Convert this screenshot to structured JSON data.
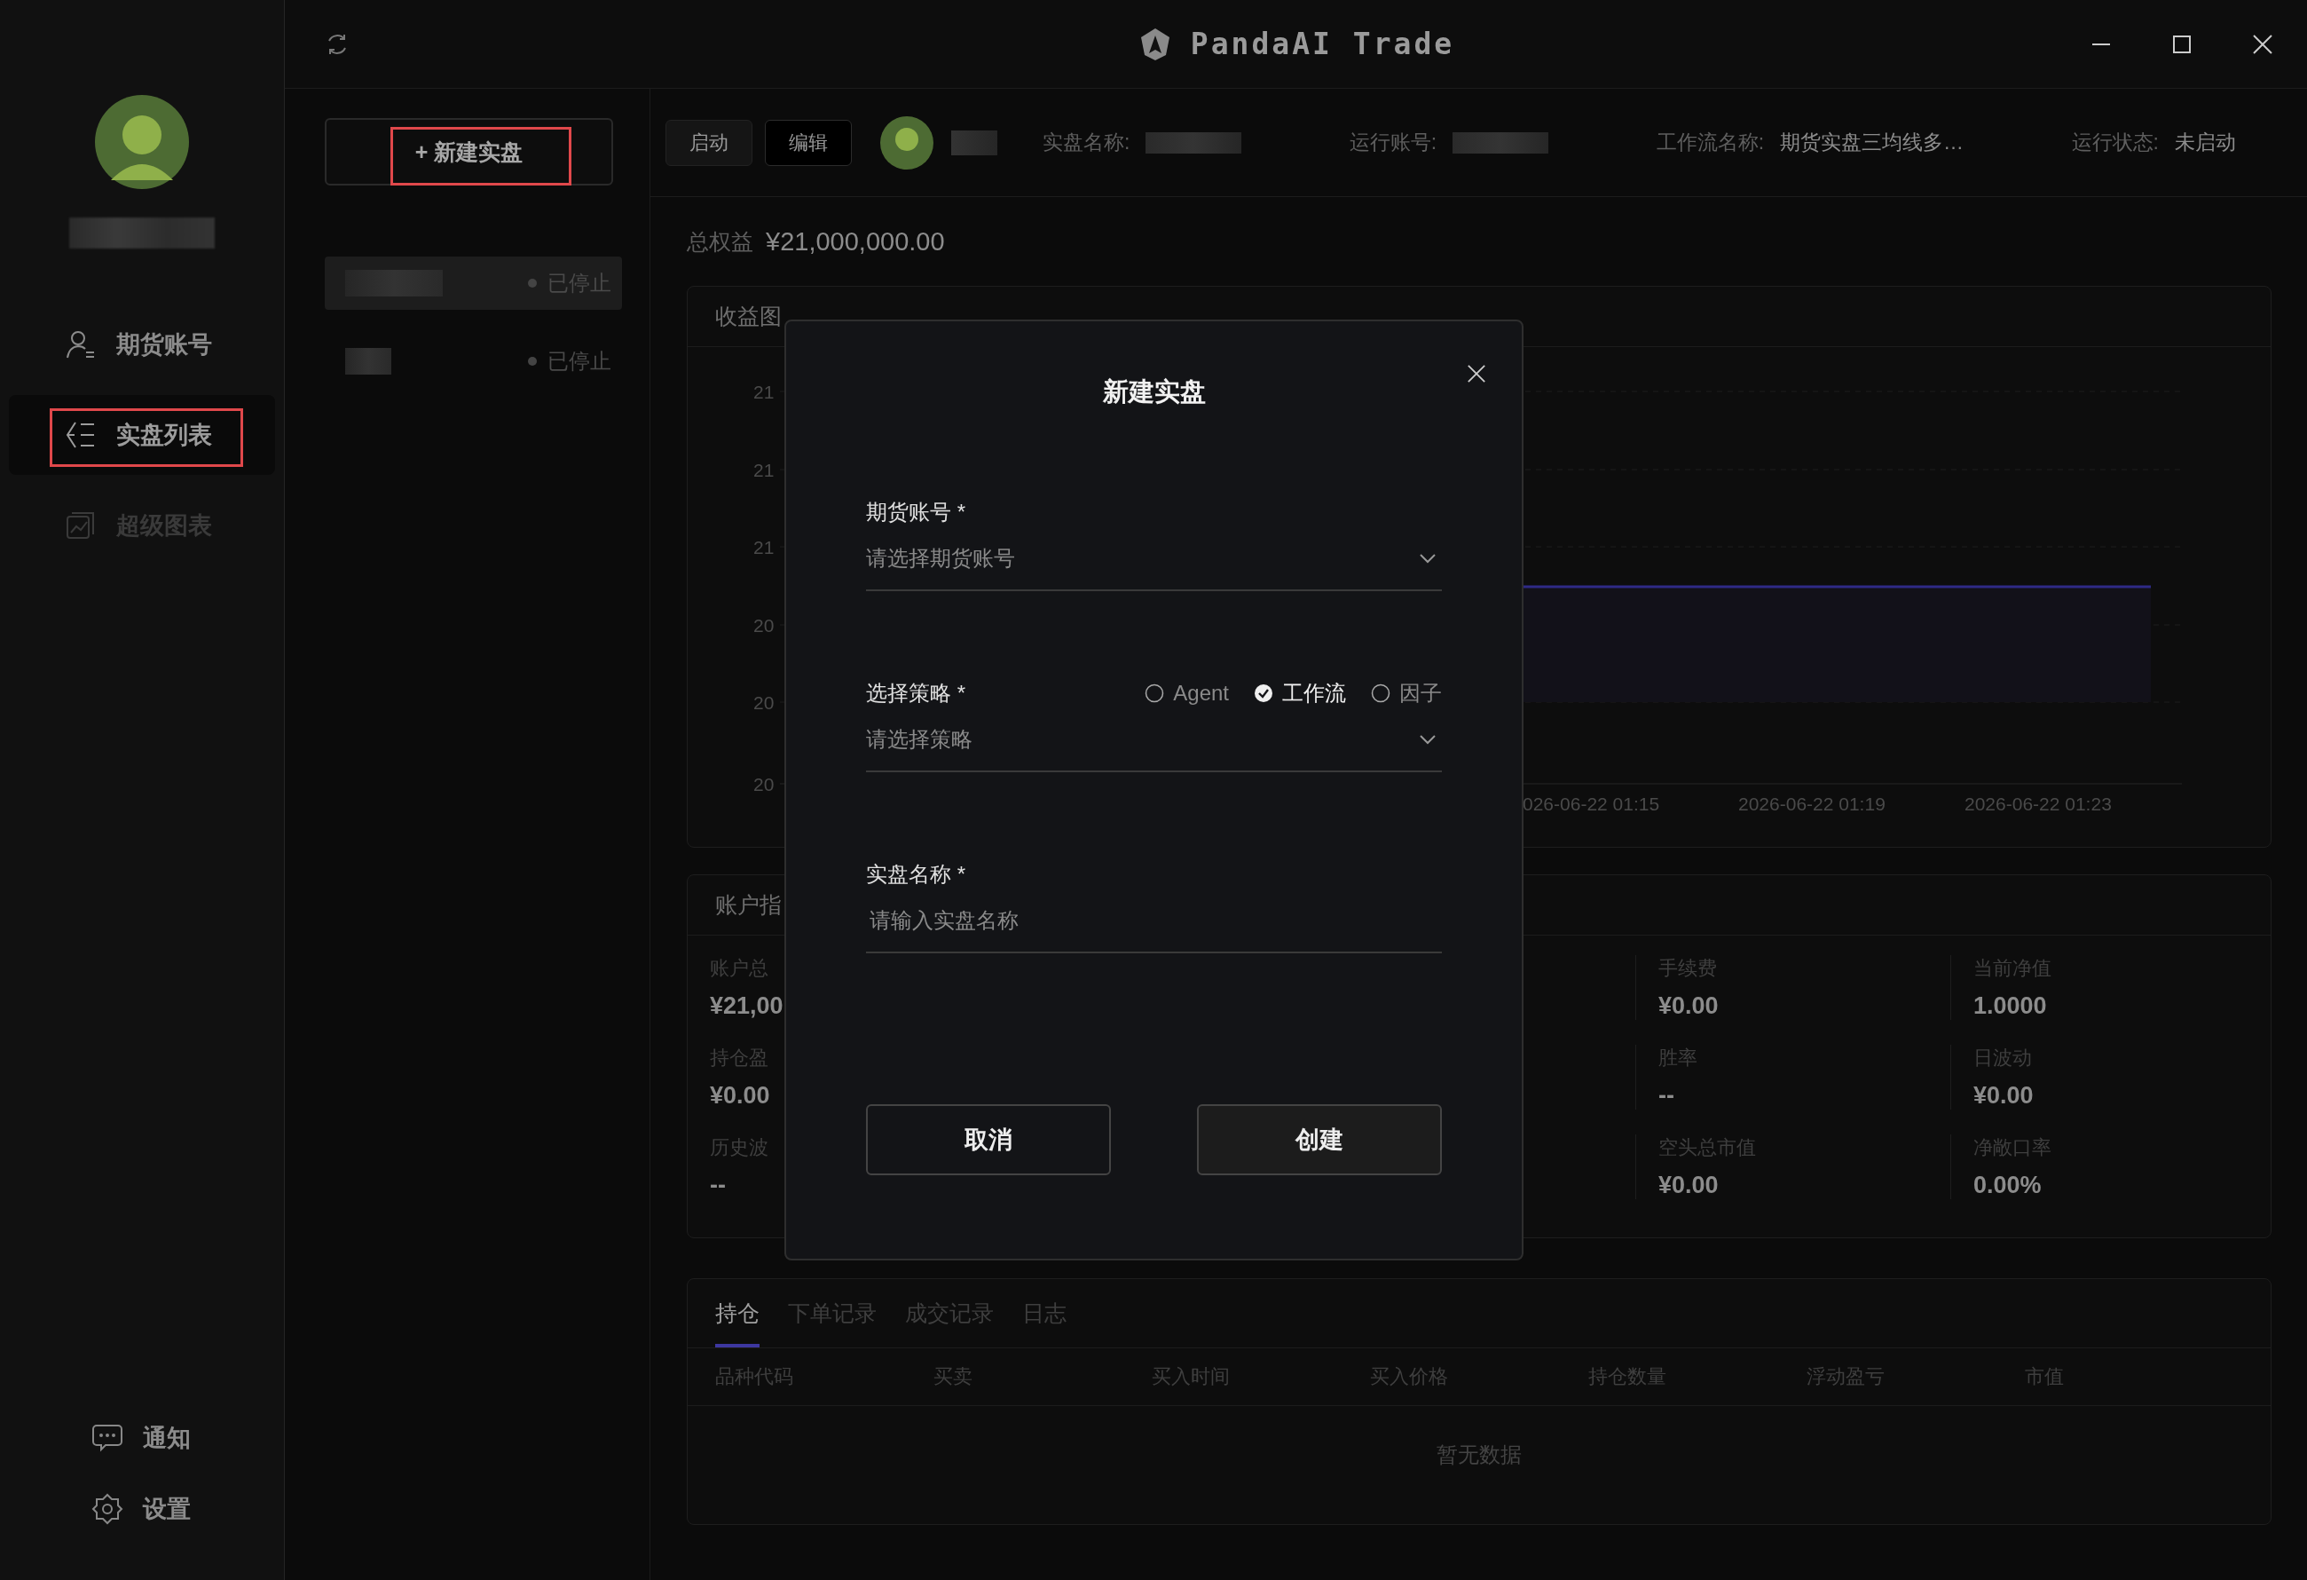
{
  "window": {
    "title": "PandaAI Trade"
  },
  "nav_items": [
    {
      "label": "期货账号",
      "selected": false,
      "disabled": false,
      "annotated": false
    },
    {
      "label": "实盘列表",
      "selected": true,
      "disabled": false,
      "annotated": true
    },
    {
      "label": "超级图表",
      "selected": false,
      "disabled": true,
      "annotated": false
    }
  ],
  "footer_items": [
    {
      "label": "通知"
    },
    {
      "label": "设置"
    }
  ],
  "new_button": {
    "label": "+ 新建实盘",
    "annotated": true
  },
  "live_list": [
    {
      "status": "已停止",
      "selected": true
    },
    {
      "status": "已停止",
      "selected": false
    }
  ],
  "header": {
    "buttons": [
      {
        "label": "启动",
        "kind": "filled"
      },
      {
        "label": "编辑",
        "kind": "outline"
      }
    ],
    "fields": [
      {
        "label": "实盘名称:",
        "kind": "redacted"
      },
      {
        "label": "运行账号:",
        "kind": "redacted"
      },
      {
        "label": "工作流名称:",
        "kind": "text",
        "value": "期货实盘三均线多…"
      },
      {
        "label": "运行状态:",
        "kind": "text",
        "value": "未启动"
      }
    ]
  },
  "total_equity": {
    "label": "总权益",
    "value": "¥21,000,000.00"
  },
  "chart": {
    "title": "收益图",
    "y_ticks": [
      "21",
      "21",
      "21",
      "20",
      "20",
      "20"
    ],
    "x_ticks": [
      "026-06-22 01:15",
      "2026-06-22 01:19",
      "2026-06-22 01:23"
    ]
  },
  "metrics": {
    "title": "账户指",
    "columns": [
      {
        "items": [
          {
            "label": "账户总",
            "value": "¥21,00"
          },
          {
            "label": "持仓盈",
            "value": "¥0.00"
          },
          {
            "label": "历史波",
            "value": "--"
          }
        ]
      },
      {
        "items": [
          {
            "label": "手续费",
            "value": "¥0.00"
          },
          {
            "label": "胜率",
            "value": "--"
          },
          {
            "label": "空头总市值",
            "value": "¥0.00"
          }
        ]
      },
      {
        "items": [
          {
            "label": "当前净值",
            "value": "1.0000"
          },
          {
            "label": "日波动",
            "value": "¥0.00"
          },
          {
            "label": "净敞口率",
            "value": "0.00%"
          }
        ]
      }
    ]
  },
  "positions": {
    "tabs": [
      {
        "label": "持仓",
        "selected": true
      },
      {
        "label": "下单记录",
        "selected": false
      },
      {
        "label": "成交记录",
        "selected": false
      },
      {
        "label": "日志",
        "selected": false
      }
    ],
    "columns": [
      "品种代码",
      "买卖",
      "买入时间",
      "买入价格",
      "持仓数量",
      "浮动盈亏",
      "市值"
    ],
    "empty_text": "暂无数据"
  },
  "dialog": {
    "title": "新建实盘",
    "fields": [
      {
        "label": "期货账号 *",
        "kind": "select",
        "placeholder": "请选择期货账号"
      },
      {
        "label": "选择策略 *",
        "kind": "select",
        "placeholder": "请选择策略",
        "options": [
          {
            "label": "Agent",
            "selected": false
          },
          {
            "label": "工作流",
            "selected": true
          },
          {
            "label": "因子",
            "selected": false
          }
        ]
      },
      {
        "label": "实盘名称 *",
        "kind": "input",
        "placeholder": "请输入实盘名称"
      }
    ],
    "buttons": [
      {
        "label": "取消",
        "kind": "secondary"
      },
      {
        "label": "创建",
        "kind": "primary"
      }
    ]
  }
}
